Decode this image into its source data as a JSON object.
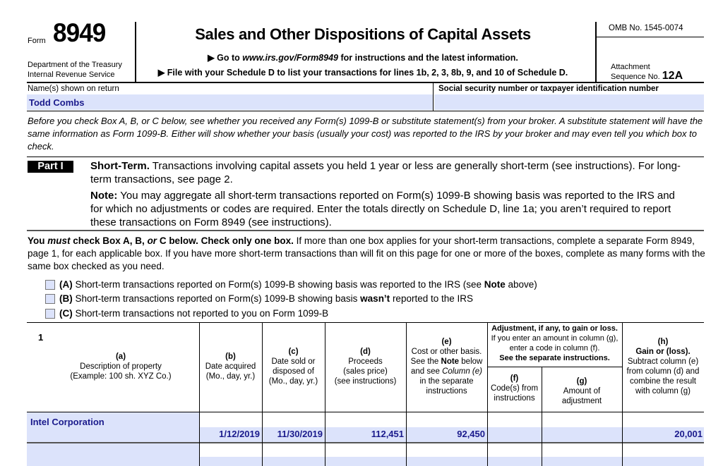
{
  "header": {
    "form_word": "Form",
    "form_number": "8949",
    "department_line1": "Department of the Treasury",
    "department_line2": "Internal Revenue Service",
    "title": "Sales and Other Dispositions of Capital Assets",
    "subtitle1_prefix": "▶ Go to ",
    "subtitle1_link": "www.irs.gov/Form8949",
    "subtitle1_suffix": " for instructions and the latest information.",
    "subtitle2": "▶ File with your Schedule D to list your transactions for lines 1b, 2, 3, 8b, 9, and 10 of Schedule D.",
    "omb": "OMB No. 1545-0074",
    "attachment_label": "Attachment",
    "sequence_label": "Sequence No.",
    "sequence_number": "12A"
  },
  "taxpayer": {
    "name_label": "Name(s) shown on return",
    "name_value": "Todd Combs",
    "ssn_label": "Social security number or taxpayer identification number",
    "ssn_value": ""
  },
  "intro_text": "Before you check Box A, B, or C below, see whether you received any Form(s) 1099-B or substitute statement(s) from your broker. A substitute statement will have the same information as Form 1099-B. Either will show whether your basis (usually your cost) was reported to the IRS by your broker and may even tell you which box to check.",
  "part1": {
    "badge": "Part I",
    "heading": "Short-Term.",
    "heading_text": " Transactions involving capital assets you held 1 year or less are generally short-term (see instructions). For long-term transactions, see page 2.",
    "note_label": "Note:",
    "note_text": " You may aggregate all short-term transactions reported on Form(s) 1099-B showing basis was reported to the IRS and for which no adjustments or codes are required. Enter the totals directly on Schedule D, line 1a; you aren’t required to report these transactions on Form 8949 (see instructions)."
  },
  "must_check": {
    "you": "You ",
    "must": "must",
    "check_box": " check Box A, B, ",
    "or": "or",
    "c_below": " C below. Check only one box.",
    "rest": " If more than one box applies for your short-term transactions, complete a separate Form 8949, page 1, for each applicable box. If you have more short-term transactions than will fit on this page for one or more of the boxes, complete as many forms with the same box checked as you need."
  },
  "checkboxes": [
    {
      "code": "(A)",
      "text_before": " Short-term transactions reported on Form(s) 1099-B showing basis was reported to the IRS (see ",
      "bold": "Note",
      "text_after": " above)",
      "checked": false
    },
    {
      "code": "(B)",
      "text_before": " Short-term transactions reported on Form(s) 1099-B showing basis ",
      "bold": "wasn’t",
      "text_after": " reported to the IRS",
      "checked": false
    },
    {
      "code": "(C)",
      "text_before": " Short-term transactions not reported to you on Form 1099-B",
      "bold": "",
      "text_after": "",
      "checked": false
    }
  ],
  "table": {
    "line_number": "1",
    "columns": {
      "a": {
        "letter": "(a)",
        "line1": "Description of property",
        "line2": "(Example: 100 sh. XYZ Co.)"
      },
      "b": {
        "letter": "(b)",
        "line1": "Date acquired",
        "line2": "(Mo., day, yr.)"
      },
      "c": {
        "letter": "(c)",
        "line1": "Date sold or",
        "line2": "disposed of",
        "line3": "(Mo., day, yr.)"
      },
      "d": {
        "letter": "(d)",
        "line1": "Proceeds",
        "line2": "(sales price)",
        "line3": "(see instructions)"
      },
      "e": {
        "letter": "(e)",
        "line1": "Cost or other basis.",
        "line2a": "See the ",
        "line2b": "Note",
        "line2c": " below",
        "line3a": "and see ",
        "line3b": "Column (e)",
        "line4": "in the separate",
        "line5": "instructions"
      },
      "adjustment": {
        "title": "Adjustment, if any, to gain or loss.",
        "line2": "If you enter an amount in column (g),",
        "line3": "enter a code in column (f).",
        "line4": "See the separate instructions."
      },
      "f": {
        "letter": "(f)",
        "line1": "Code(s) from",
        "line2": "instructions"
      },
      "g": {
        "letter": "(g)",
        "line1": "Amount of",
        "line2": "adjustment"
      },
      "h": {
        "letter": "(h)",
        "title": "Gain or (loss).",
        "line1": "Subtract column (e)",
        "line2": "from column (d) and",
        "line3": "combine the result",
        "line4": "with column (g)"
      }
    },
    "rows": [
      {
        "description": "Intel Corporation",
        "date_acquired": "1/12/2019",
        "date_sold": "11/30/2019",
        "proceeds": "112,451",
        "cost_basis": "92,450",
        "code": "",
        "adjustment": "",
        "gain_loss": "20,001"
      },
      {
        "description": "",
        "date_acquired": "",
        "date_sold": "",
        "proceeds": "",
        "cost_basis": "",
        "code": "",
        "adjustment": "",
        "gain_loss": ""
      }
    ]
  },
  "colors": {
    "field_fill": "#dce3fb",
    "field_text": "#1a1a8c"
  }
}
